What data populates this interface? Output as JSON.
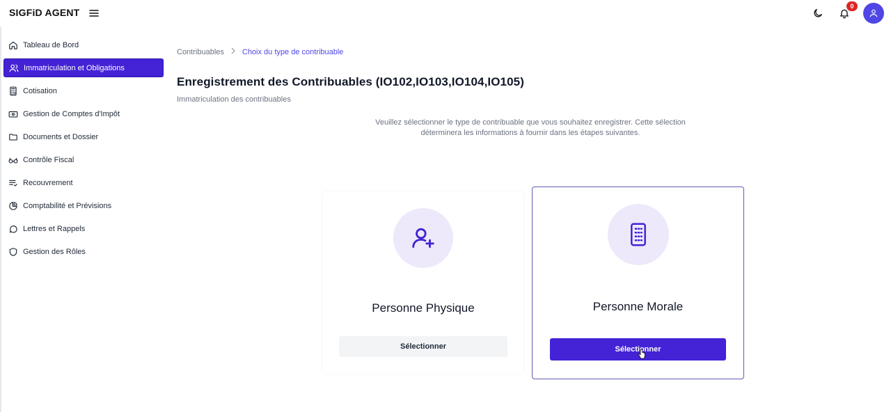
{
  "header": {
    "brand": "SIGFiD AGENT",
    "notification_count": "0",
    "icons": [
      "menu-icon",
      "moon-icon",
      "bell-icon",
      "user-icon"
    ]
  },
  "sidebar": {
    "items": [
      {
        "label": "Tableau de Bord",
        "icon": "home-icon"
      },
      {
        "label": "Immatriculation et Obligations",
        "icon": "users-icon"
      },
      {
        "label": "Cotisation",
        "icon": "calculator-icon"
      },
      {
        "label": "Gestion de Comptes d'Impôt",
        "icon": "wallet-icon"
      },
      {
        "label": "Documents et Dossier",
        "icon": "folder-icon"
      },
      {
        "label": "Contrôle Fiscal",
        "icon": "glasses-icon"
      },
      {
        "label": "Recouvrement",
        "icon": "list-check-icon"
      },
      {
        "label": "Comptabilité et Prévisions",
        "icon": "pie-chart-icon"
      },
      {
        "label": "Lettres et Rappels",
        "icon": "message-icon"
      },
      {
        "label": "Gestion des Rôles",
        "icon": "shield-icon"
      }
    ],
    "active_index": 1
  },
  "breadcrumb": {
    "root": "Contribuables",
    "separator": ">",
    "current": "Choix du type de contribuable"
  },
  "page": {
    "title": "Enregistrement des Contribuables (IO102,IO103,IO104,IO105)",
    "subtitle": "Immatriculation des contribuables",
    "intro_line1": "Veuillez sélectionner le type de contribuable que vous souhaitez enregistrer. Cette sélection",
    "intro_line2": "déterminera les informations à fournir dans les étapes suivantes."
  },
  "cards": [
    {
      "title": "Personne Physique",
      "button": "Sélectionner",
      "icon": "user-plus-icon",
      "selected": false
    },
    {
      "title": "Personne Morale",
      "button": "Sélectionner",
      "icon": "building-icon",
      "selected": true
    }
  ],
  "colors": {
    "accent": "#4422d6",
    "accent_light": "#ede9fb",
    "badge": "#dc2626"
  }
}
